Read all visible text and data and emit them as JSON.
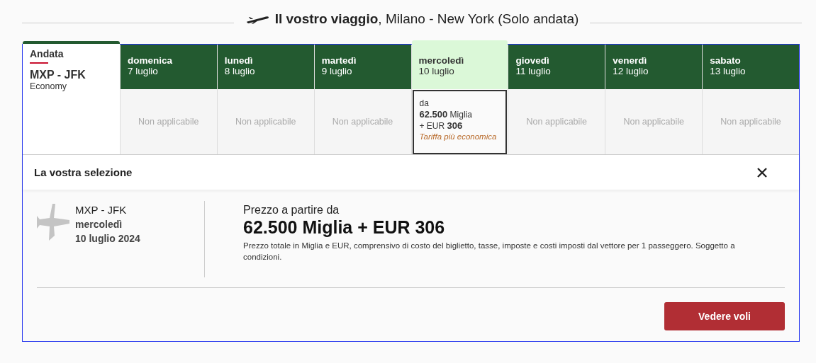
{
  "heading": {
    "bold": "Il vostro viaggio",
    "rest": ", Milano - New York (Solo andata)"
  },
  "leg": {
    "label": "Andata",
    "route": "MXP - JFK",
    "cabin": "Economy"
  },
  "days": [
    {
      "weekday": "domenica",
      "date": "7 luglio",
      "selected": false,
      "kind": "unavailable",
      "text": "Non applicabile"
    },
    {
      "weekday": "lunedì",
      "date": "8 luglio",
      "selected": false,
      "kind": "unavailable",
      "text": "Non applicabile"
    },
    {
      "weekday": "martedì",
      "date": "9 luglio",
      "selected": false,
      "kind": "unavailable",
      "text": "Non applicabile"
    },
    {
      "weekday": "mercoledì",
      "date": "10 luglio",
      "selected": true,
      "kind": "fare",
      "from": "da",
      "miles": "62.500",
      "miles_unit": "Miglia",
      "cash": "+ EUR",
      "amount": "306",
      "tag": "Tariffa più economica"
    },
    {
      "weekday": "giovedì",
      "date": "11 luglio",
      "selected": false,
      "kind": "unavailable",
      "text": "Non applicabile"
    },
    {
      "weekday": "venerdì",
      "date": "12 luglio",
      "selected": false,
      "kind": "unavailable",
      "text": "Non applicabile"
    },
    {
      "weekday": "sabato",
      "date": "13 luglio",
      "selected": false,
      "kind": "unavailable",
      "text": "Non applicabile"
    }
  ],
  "selection": {
    "title": "La vostra selezione",
    "route": "MXP - JFK",
    "weekday": "mercoledì",
    "date": "10 luglio 2024",
    "price_label": "Prezzo a partire da",
    "price": "62.500 Miglia + EUR 306",
    "note": "Prezzo totale in Miglia e EUR, comprensivo di costo del biglietto, tasse, imposte e costi imposti dal vettore per 1 passeggero. Soggetto a condizioni.",
    "button": "Vedere voli"
  }
}
